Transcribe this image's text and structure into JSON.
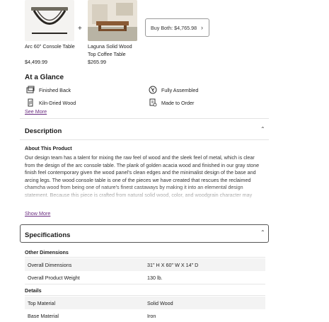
{
  "bundle": {
    "products": [
      {
        "name_line1": "Arc 60\" Console Table",
        "name_line2": "",
        "price": "$4,499.99"
      },
      {
        "name_line1": "Laguna Solid Wood",
        "name_line2": "Top Coffee Table",
        "price": "$265.99"
      }
    ],
    "plus_symbol": "+",
    "buy_both_label": "Buy Both: $4,765.98"
  },
  "glance": {
    "title": "At a Glance",
    "features": [
      {
        "label": "Finished Back",
        "icon": "finished-back-icon"
      },
      {
        "label": "Fully Assembled",
        "icon": "fully-assembled-icon"
      },
      {
        "label": "Kiln-Dried Wood",
        "icon": "kiln-dried-wood-icon"
      },
      {
        "label": "Made to Order",
        "icon": "made-to-order-icon"
      }
    ],
    "see_more": "See More"
  },
  "description": {
    "title": "Description",
    "about_heading": "About This Product",
    "text": "Our design team has a talent for mixing the raw feel of wood and the sleek feel of metal, which is clear from the design of the arc console table. The plank of golden acacia wood and finished in our gray stone finish feel contemporary given the wood panel's clean edges and the minimalist design of the base and arcing legs. The wood console table is one of the pieces we have created that rescues the reclaimed chamcha wood from being one of nature's finest castaways by making it into an elemental design statement. Because this piece is crafted from natural solid wood, color, and woodgrain character may",
    "show_more": "Show More"
  },
  "specifications": {
    "title": "Specifications",
    "groups": [
      {
        "heading": "Other Dimensions",
        "rows": [
          {
            "key": "Overall Dimensions",
            "value": "31\" H X 60\" W X 14\" D"
          },
          {
            "key": "Overall Product Weight",
            "value": "130 lb."
          }
        ]
      },
      {
        "heading": "Details",
        "rows": [
          {
            "key": "Top Material",
            "value": "Solid Wood"
          },
          {
            "key": "Base Material",
            "value": "Iron"
          }
        ]
      }
    ]
  },
  "colors": {
    "link": "#6a2d80",
    "row_shade": "#f3f3f3"
  }
}
